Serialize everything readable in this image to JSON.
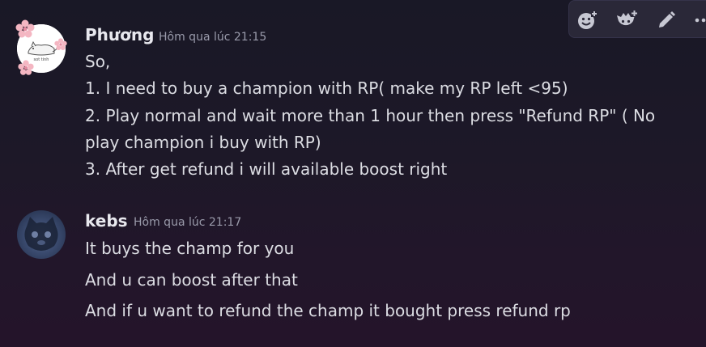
{
  "toolbar": {
    "buttons": [
      {
        "icon": "add-reaction-icon"
      },
      {
        "icon": "add-super-reaction-icon"
      },
      {
        "icon": "edit-pencil-icon"
      },
      {
        "icon": "more-options-icon"
      }
    ]
  },
  "messages": [
    {
      "author": "Phương",
      "timestamp": "Hôm qua lúc 21:15",
      "avatar_text": "sot tinh",
      "lines": [
        "So,",
        "1.  I need to buy a champion with RP( make my RP left <95)",
        "2. Play normal and wait more than 1 hour then press \"Refund RP\" ( No",
        "play champion i buy with RP)",
        "3. After get refund i will available boost right"
      ]
    },
    {
      "author": "kebs",
      "timestamp": "Hôm qua lúc 21:17",
      "lines": [
        "It buys the champ for you",
        "And u can boost after that",
        "And if u want to refund the champ it bought press refund rp"
      ]
    }
  ],
  "colors": {
    "background": "#1d1828",
    "toolbar_bg": "#2a2838",
    "username": "#e8e8ee",
    "timestamp": "#9a9bab",
    "text": "#dcdde3"
  }
}
